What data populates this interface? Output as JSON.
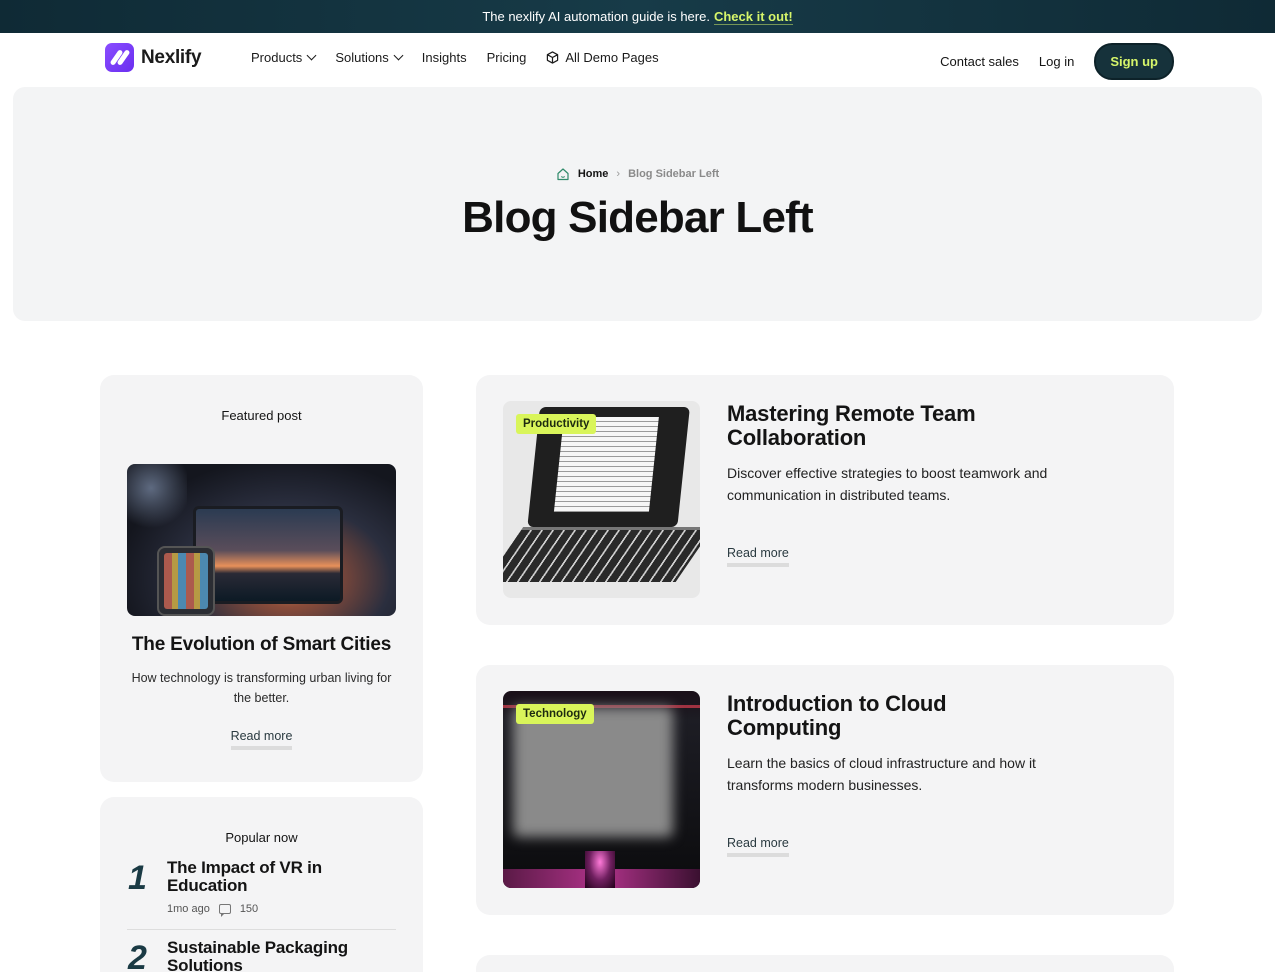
{
  "announcement": {
    "text": "The nexlify AI automation guide is here.",
    "link": "Check it out!"
  },
  "nav": {
    "brand": "Nexlify",
    "menu": {
      "products": "Products",
      "solutions": "Solutions",
      "insights": "Insights",
      "pricing": "Pricing",
      "demo": "All Demo Pages"
    },
    "contact": "Contact sales",
    "login": "Log in",
    "signup": "Sign up"
  },
  "hero": {
    "breadcrumb_home": "Home",
    "breadcrumb_current": "Blog Sidebar Left",
    "title": "Blog Sidebar Left"
  },
  "featured": {
    "heading": "Featured post",
    "title": "The Evolution of Smart Cities",
    "excerpt": "How technology is transforming urban living for the better.",
    "read_more": "Read more"
  },
  "popular": {
    "heading": "Popular now",
    "items": [
      {
        "num": "1",
        "title": "The Impact of VR in Education",
        "age": "1mo ago",
        "comments": "150"
      },
      {
        "num": "2",
        "title": "Sustainable Packaging Solutions"
      }
    ]
  },
  "posts": [
    {
      "tag": "Productivity",
      "title": "Mastering Remote Team Collaboration",
      "excerpt": "Discover effective strategies to boost teamwork and communication in distributed teams.",
      "read_more": "Read more"
    },
    {
      "tag": "Technology",
      "title": "Introduction to Cloud Computing",
      "excerpt": "Learn the basics of cloud infrastructure and how it transforms modern businesses.",
      "read_more": "Read more"
    }
  ],
  "colors": {
    "accent_lime": "#d6f56a",
    "dark_teal": "#16323b",
    "brand_purple": "#7a3cf5",
    "card_bg": "#f4f4f5"
  }
}
